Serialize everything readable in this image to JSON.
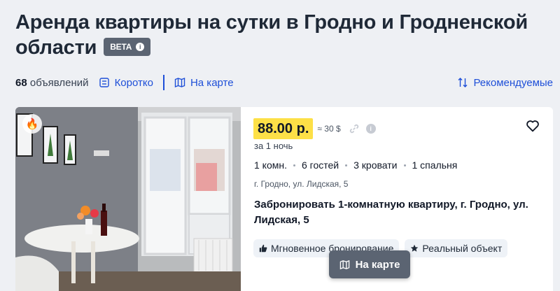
{
  "header": {
    "title": "Аренда квартиры на сутки в Гродно и Гродненской области",
    "badge": "BETA",
    "badge_info": "i"
  },
  "toolbar": {
    "count_number": "68",
    "count_label": "объявлений",
    "short_view": "Коротко",
    "on_map": "На карте",
    "sort": "Рекомендуемые"
  },
  "listing": {
    "price": "88.00 р.",
    "usd": "≈ 30 $",
    "info": "i",
    "per_night": "за 1 ночь",
    "features": [
      "1 комн.",
      "6 гостей",
      "3 кровати",
      "1 спальня"
    ],
    "address": "г. Гродно, ул. Лидская, 5",
    "title": "Забронировать 1-комнатную квартиру, г. Гродно, ул. Лидская, 5",
    "tags": [
      "Мгновенное бронирование",
      "Реальный объект"
    ]
  },
  "map_button": {
    "label": "На карте"
  },
  "colors": {
    "accent": "#1e4fd8",
    "price_bg": "#fde047",
    "badge_bg": "#5b6472"
  }
}
